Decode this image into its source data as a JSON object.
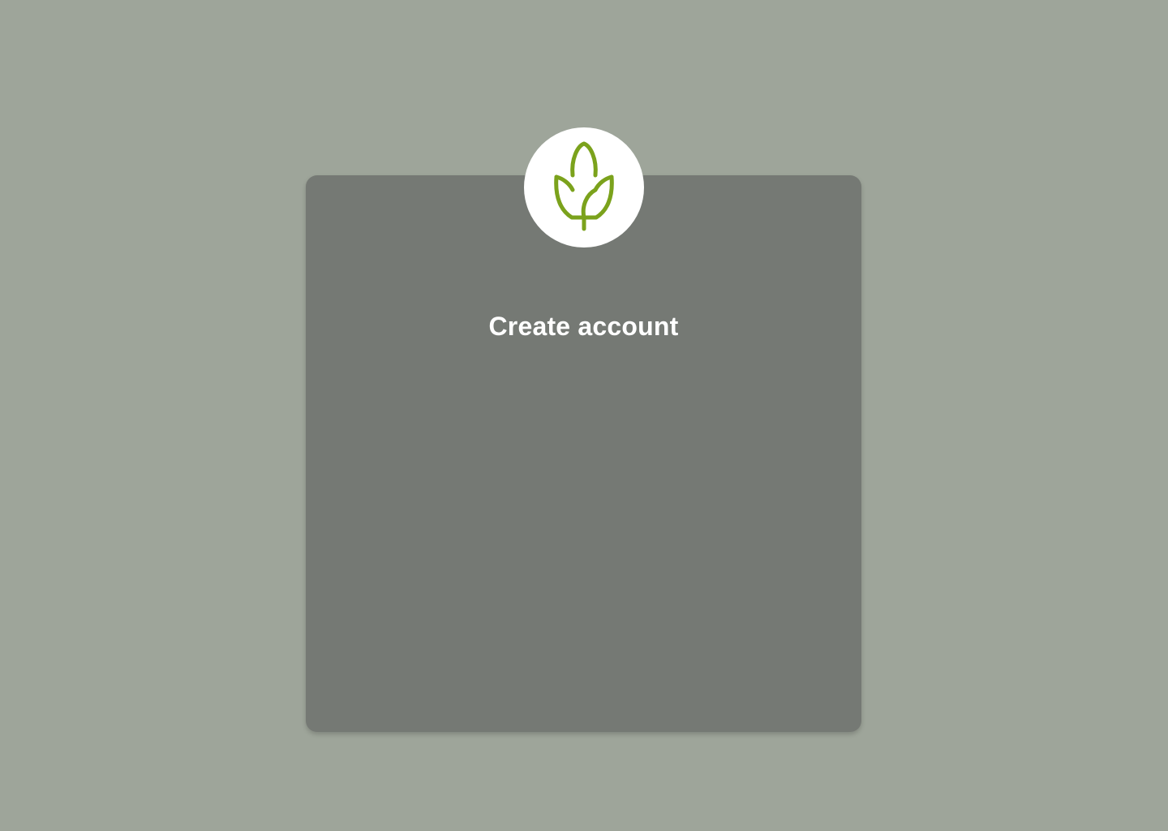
{
  "signup": {
    "title": "Create account"
  },
  "brand": {
    "logo_icon": "corn-leaf-icon",
    "logo_color": "#7ba21c"
  },
  "colors": {
    "background": "#9ea59a",
    "card": "#757974"
  }
}
